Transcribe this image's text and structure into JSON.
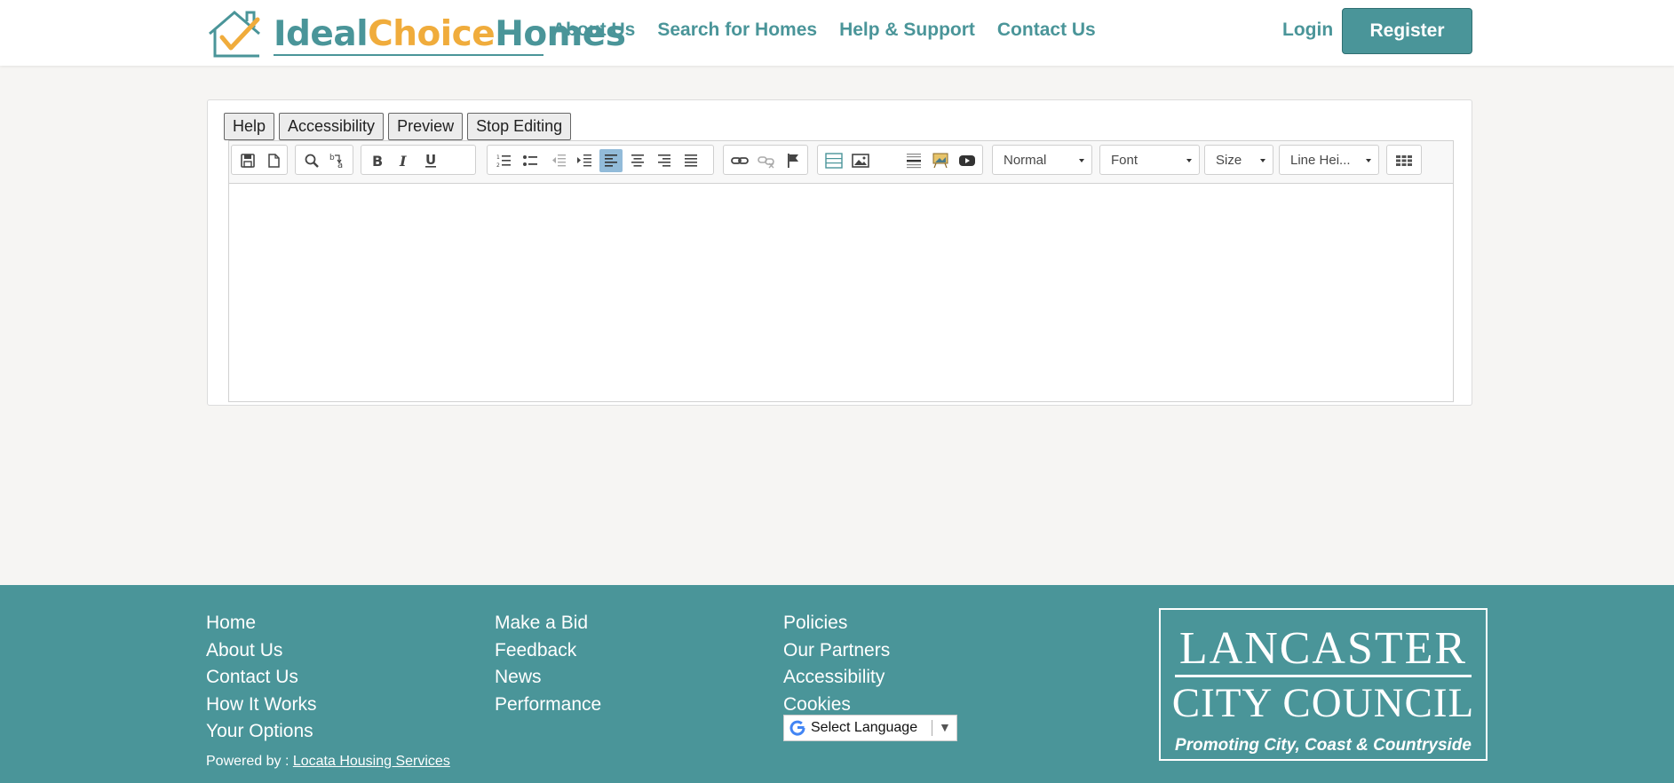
{
  "header": {
    "logo": {
      "part1": "Ideal",
      "part2": "Choice",
      "part3": "Homes"
    },
    "nav": [
      "About Us",
      "Search for Homes",
      "Help & Support",
      "Contact Us"
    ],
    "login_label": "Login",
    "register_label": "Register"
  },
  "editor": {
    "mode_buttons": [
      "Help",
      "Accessibility",
      "Preview",
      "Stop Editing"
    ],
    "combos": {
      "format": "Normal",
      "font": "Font",
      "size": "Size",
      "line_height": "Line Hei..."
    },
    "toolbar_icons": [
      "save-icon",
      "new-page-icon",
      "find-icon",
      "replace-icon",
      "bold-icon",
      "italic-icon",
      "underline-icon",
      "numbered-list-icon",
      "bulleted-list-icon",
      "outdent-icon",
      "indent-icon",
      "align-left-icon",
      "align-center-icon",
      "align-right-icon",
      "justify-icon",
      "link-icon",
      "unlink-icon",
      "anchor-icon",
      "template-icon",
      "image-icon",
      "horizontal-line-icon",
      "image-gallery-icon",
      "video-icon",
      "table-icon"
    ],
    "active_alignment": "left"
  },
  "footer": {
    "col1": [
      "Home",
      "About Us",
      "Contact Us",
      "How It Works",
      "Your Options"
    ],
    "col2": [
      "Make a Bid",
      "Feedback",
      "News",
      "Performance"
    ],
    "col3": [
      "Policies",
      "Our Partners",
      "Accessibility",
      "Cookies"
    ],
    "powered_prefix": "Powered by :",
    "powered_link": "Locata Housing Services",
    "language_select": "Select Language",
    "council": {
      "line1": "LANCASTER",
      "line2": "CITY COUNCIL",
      "tagline": "Promoting City, Coast & Countryside"
    }
  },
  "colors": {
    "brand_teal": "#4a9599",
    "brand_orange": "#f0ac3c",
    "page_bg": "#f6f5f3",
    "active_button": "#92bbd9"
  }
}
